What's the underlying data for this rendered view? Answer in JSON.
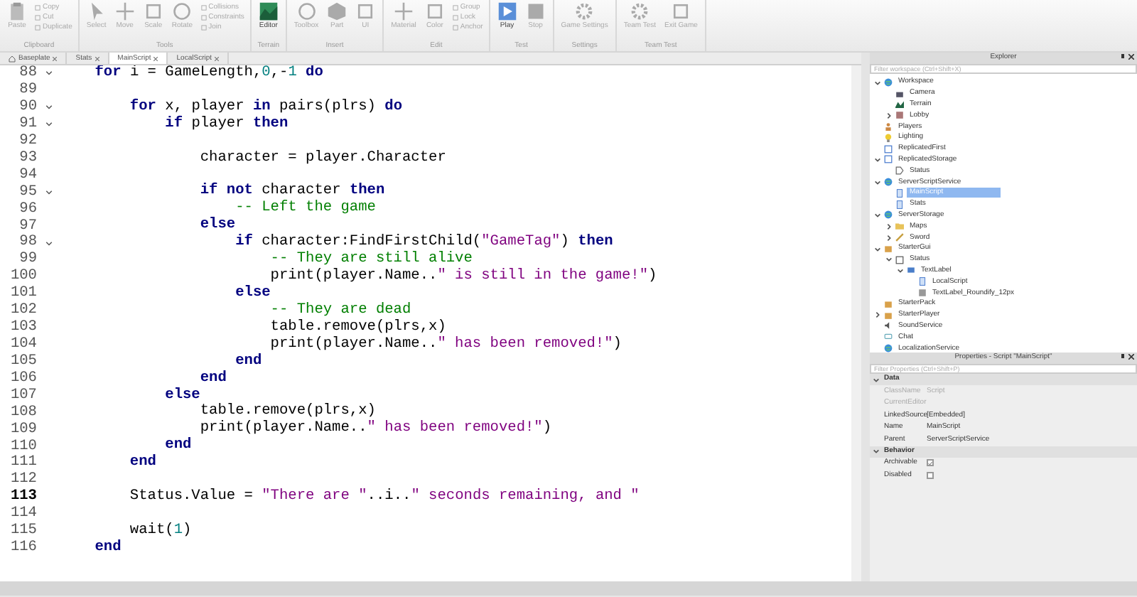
{
  "ribbon": [
    {
      "label": "Clipboard",
      "buttons": [
        {
          "label": "Paste",
          "kind": "clipboard"
        },
        {
          "label": "Copy",
          "kind": "small"
        },
        {
          "label": "Cut",
          "kind": "small"
        },
        {
          "label": "Duplicate",
          "kind": "small"
        }
      ]
    },
    {
      "label": "Tools",
      "buttons": [
        {
          "label": "Select",
          "kind": "pointer"
        },
        {
          "label": "Move",
          "kind": "cross"
        },
        {
          "label": "Scale",
          "kind": "square"
        },
        {
          "label": "Rotate",
          "kind": "circle"
        },
        {
          "label": "Collisions",
          "kind": "small"
        },
        {
          "label": "Constraints",
          "kind": "small"
        },
        {
          "label": "Join",
          "kind": "small"
        }
      ]
    },
    {
      "label": "Terrain",
      "buttons": [
        {
          "label": "Editor",
          "kind": "terrain"
        }
      ]
    },
    {
      "label": "Insert",
      "buttons": [
        {
          "label": "Toolbox",
          "kind": "circle"
        },
        {
          "label": "Part",
          "kind": "cube"
        },
        {
          "label": "UI",
          "kind": "square"
        }
      ]
    },
    {
      "label": "Edit",
      "buttons": [
        {
          "label": "Material",
          "kind": "cross"
        },
        {
          "label": "Color",
          "kind": "square"
        },
        {
          "label": "Group",
          "kind": "small"
        },
        {
          "label": "Lock",
          "kind": "small"
        },
        {
          "label": "Anchor",
          "kind": "small"
        }
      ]
    },
    {
      "label": "Test",
      "buttons": [
        {
          "label": "Play",
          "kind": "play"
        },
        {
          "label": "Stop",
          "kind": "stop"
        }
      ]
    },
    {
      "label": "Settings",
      "buttons": [
        {
          "label": "Game Settings",
          "kind": "gear"
        }
      ]
    },
    {
      "label": "Team Test",
      "buttons": [
        {
          "label": "Team Test",
          "kind": "gear"
        },
        {
          "label": "Exit Game",
          "kind": "square"
        }
      ]
    }
  ],
  "tabs": [
    {
      "label": "Baseplate",
      "selected": false,
      "kind": "home"
    },
    {
      "label": "Stats",
      "selected": false
    },
    {
      "label": "MainScript",
      "selected": true
    },
    {
      "label": "LocalScript",
      "selected": false
    }
  ],
  "editor": {
    "lines": [
      {
        "number": "88",
        "fold": true,
        "current": false,
        "tokens": [
          {
            "kind": "keyword",
            "text": "    for"
          },
          {
            "kind": "plain",
            "text": " i = GameLength,"
          },
          {
            "kind": "number",
            "text": "0"
          },
          {
            "kind": "plain",
            "text": ",-"
          },
          {
            "kind": "number",
            "text": "1"
          },
          {
            "kind": "keyword",
            "text": " do"
          }
        ]
      },
      {
        "number": "89",
        "fold": false,
        "current": false
      },
      {
        "number": "90",
        "fold": true,
        "current": false,
        "tokens": [
          {
            "kind": "keyword",
            "text": "        for"
          },
          {
            "kind": "plain",
            "text": " x, player "
          },
          {
            "kind": "keyword",
            "text": "in"
          },
          {
            "kind": "plain",
            "text": " pairs(plrs) "
          },
          {
            "kind": "keyword",
            "text": "do"
          }
        ]
      },
      {
        "number": "91",
        "fold": true,
        "current": false,
        "tokens": [
          {
            "kind": "keyword",
            "text": "            if"
          },
          {
            "kind": "plain",
            "text": " player "
          },
          {
            "kind": "keyword",
            "text": "then"
          }
        ]
      },
      {
        "number": "92",
        "fold": false,
        "current": false
      },
      {
        "number": "93",
        "fold": false,
        "current": false,
        "tokens": [
          {
            "kind": "plain",
            "text": "                character = player.Character"
          }
        ]
      },
      {
        "number": "94",
        "fold": false,
        "current": false
      },
      {
        "number": "95",
        "fold": true,
        "current": false,
        "tokens": [
          {
            "kind": "keyword",
            "text": "                if not"
          },
          {
            "kind": "plain",
            "text": " character "
          },
          {
            "kind": "keyword",
            "text": "then"
          }
        ]
      },
      {
        "number": "96",
        "fold": false,
        "current": false,
        "tokens": [
          {
            "kind": "comment",
            "text": "                    -- Left the game"
          }
        ]
      },
      {
        "number": "97",
        "fold": false,
        "current": false,
        "tokens": [
          {
            "kind": "keyword",
            "text": "                else"
          }
        ]
      },
      {
        "number": "98",
        "fold": true,
        "current": false,
        "tokens": [
          {
            "kind": "keyword",
            "text": "                    if"
          },
          {
            "kind": "plain",
            "text": " character:FindFirstChild("
          },
          {
            "kind": "string",
            "text": "\"GameTag\""
          },
          {
            "kind": "plain",
            "text": ") "
          },
          {
            "kind": "keyword",
            "text": "then"
          }
        ]
      },
      {
        "number": "99",
        "fold": false,
        "current": false,
        "tokens": [
          {
            "kind": "comment",
            "text": "                        -- They are still alive"
          }
        ]
      },
      {
        "number": "100",
        "fold": false,
        "current": false,
        "tokens": [
          {
            "kind": "plain",
            "text": "                        print(player.Name.."
          },
          {
            "kind": "string",
            "text": "\" is still in the game!\""
          },
          {
            "kind": "plain",
            "text": ")"
          }
        ]
      },
      {
        "number": "101",
        "fold": false,
        "current": false,
        "tokens": [
          {
            "kind": "keyword",
            "text": "                    else"
          }
        ]
      },
      {
        "number": "102",
        "fold": false,
        "current": false,
        "tokens": [
          {
            "kind": "comment",
            "text": "                        -- They are dead"
          }
        ]
      },
      {
        "number": "103",
        "fold": false,
        "current": false,
        "tokens": [
          {
            "kind": "plain",
            "text": "                        table.remove(plrs,x)"
          }
        ]
      },
      {
        "number": "104",
        "fold": false,
        "current": false,
        "tokens": [
          {
            "kind": "plain",
            "text": "                        print(player.Name.."
          },
          {
            "kind": "string",
            "text": "\" has been removed!\""
          },
          {
            "kind": "plain",
            "text": ")"
          }
        ]
      },
      {
        "number": "105",
        "fold": false,
        "current": false,
        "tokens": [
          {
            "kind": "keyword",
            "text": "                    end"
          }
        ]
      },
      {
        "number": "106",
        "fold": false,
        "current": false,
        "tokens": [
          {
            "kind": "keyword",
            "text": "                end"
          }
        ]
      },
      {
        "number": "107",
        "fold": false,
        "current": false,
        "tokens": [
          {
            "kind": "keyword",
            "text": "            else"
          }
        ]
      },
      {
        "number": "108",
        "fold": false,
        "current": false,
        "tokens": [
          {
            "kind": "plain",
            "text": "                table.remove(plrs,x)"
          }
        ]
      },
      {
        "number": "109",
        "fold": false,
        "current": false,
        "tokens": [
          {
            "kind": "plain",
            "text": "                print(player.Name.."
          },
          {
            "kind": "string",
            "text": "\" has been removed!\""
          },
          {
            "kind": "plain",
            "text": ")"
          }
        ]
      },
      {
        "number": "110",
        "fold": false,
        "current": false,
        "tokens": [
          {
            "kind": "keyword",
            "text": "            end"
          }
        ]
      },
      {
        "number": "111",
        "fold": false,
        "current": false,
        "tokens": [
          {
            "kind": "keyword",
            "text": "        end"
          }
        ]
      },
      {
        "number": "112",
        "fold": false,
        "current": false
      },
      {
        "number": "113",
        "fold": false,
        "current": true,
        "tokens": [
          {
            "kind": "plain",
            "text": "        Status.Value = "
          },
          {
            "kind": "string",
            "text": "\"There are \""
          },
          {
            "kind": "plain",
            "text": "..i.."
          },
          {
            "kind": "string",
            "text": "\" seconds remaining, and \""
          }
        ]
      },
      {
        "number": "114",
        "fold": false,
        "current": false
      },
      {
        "number": "115",
        "fold": false,
        "current": false,
        "tokens": [
          {
            "kind": "plain",
            "text": "        wait("
          },
          {
            "kind": "number",
            "text": "1"
          },
          {
            "kind": "plain",
            "text": ")"
          }
        ]
      },
      {
        "number": "116",
        "fold": false,
        "current": false,
        "tokens": [
          {
            "kind": "keyword",
            "text": "    end"
          }
        ]
      }
    ]
  },
  "explorer": {
    "title": "Explorer",
    "filter": {
      "placeholder": "Filter workspace (Ctrl+Shift+X)"
    },
    "items": [
      {
        "label": "Workspace",
        "kind": "globe",
        "selected": false,
        "expanded": true,
        "children": [
          {
            "label": "Camera",
            "kind": "camera",
            "selected": false
          },
          {
            "label": "Terrain",
            "kind": "terrain",
            "selected": false
          },
          {
            "label": "Lobby",
            "kind": "model",
            "selected": false,
            "expanded": false
          }
        ]
      },
      {
        "label": "Players",
        "kind": "people",
        "selected": false
      },
      {
        "label": "Lighting",
        "kind": "bulb",
        "selected": false
      },
      {
        "label": "ReplicatedFirst",
        "kind": "service",
        "selected": false
      },
      {
        "label": "ReplicatedStorage",
        "kind": "service",
        "selected": false,
        "expanded": true,
        "children": [
          {
            "label": "Status",
            "kind": "value",
            "selected": false
          }
        ]
      },
      {
        "label": "ServerScriptService",
        "kind": "globe",
        "selected": false,
        "expanded": true,
        "children": [
          {
            "label": "MainScript",
            "kind": "script",
            "selected": true
          },
          {
            "label": "Stats",
            "kind": "script",
            "selected": false
          }
        ]
      },
      {
        "label": "ServerStorage",
        "kind": "globe",
        "selected": false,
        "expanded": true,
        "children": [
          {
            "label": "Maps",
            "kind": "folder",
            "selected": false,
            "expanded": false
          },
          {
            "label": "Sword",
            "kind": "tool",
            "selected": false,
            "expanded": false
          }
        ]
      },
      {
        "label": "StarterGui",
        "kind": "gui",
        "selected": false,
        "expanded": true,
        "children": [
          {
            "label": "Status",
            "kind": "frame",
            "selected": false,
            "expanded": true,
            "children": [
              {
                "label": "TextLabel",
                "kind": "label",
                "selected": false,
                "expanded": true,
                "children": [
                  {
                    "label": "LocalScript",
                    "kind": "script",
                    "selected": false
                  },
                  {
                    "label": "TextLabel_Roundify_12px",
                    "kind": "image",
                    "selected": false
                  }
                ]
              }
            ]
          }
        ]
      },
      {
        "label": "StarterPack",
        "kind": "gui",
        "selected": false
      },
      {
        "label": "StarterPlayer",
        "kind": "gui",
        "selected": false,
        "expanded": false
      },
      {
        "label": "SoundService",
        "kind": "sound",
        "selected": false
      },
      {
        "label": "Chat",
        "kind": "chat",
        "selected": false
      },
      {
        "label": "LocalizationService",
        "kind": "globe",
        "selected": false
      }
    ]
  },
  "properties": {
    "title": "Properties - Script \"MainScript\"",
    "filter": {
      "placeholder": "Filter Properties (Ctrl+Shift+P)"
    },
    "groups": [
      {
        "label": "Data",
        "expanded": true,
        "rows": [
          {
            "name": "ClassName",
            "kind": "text",
            "value": "Script",
            "disabled": true
          },
          {
            "name": "CurrentEditor",
            "kind": "text",
            "disabled": true
          },
          {
            "name": "LinkedSource",
            "kind": "text",
            "value": "[Embedded]",
            "disabled": false
          },
          {
            "name": "Name",
            "kind": "text",
            "value": "MainScript",
            "disabled": false
          },
          {
            "name": "Parent",
            "kind": "text",
            "value": "ServerScriptService",
            "disabled": false
          }
        ]
      },
      {
        "label": "Behavior",
        "expanded": true,
        "rows": [
          {
            "name": "Archivable",
            "kind": "checkbox",
            "checked": true,
            "disabled": false
          },
          {
            "name": "Disabled",
            "kind": "checkbox",
            "checked": false,
            "disabled": false
          }
        ]
      }
    ]
  }
}
